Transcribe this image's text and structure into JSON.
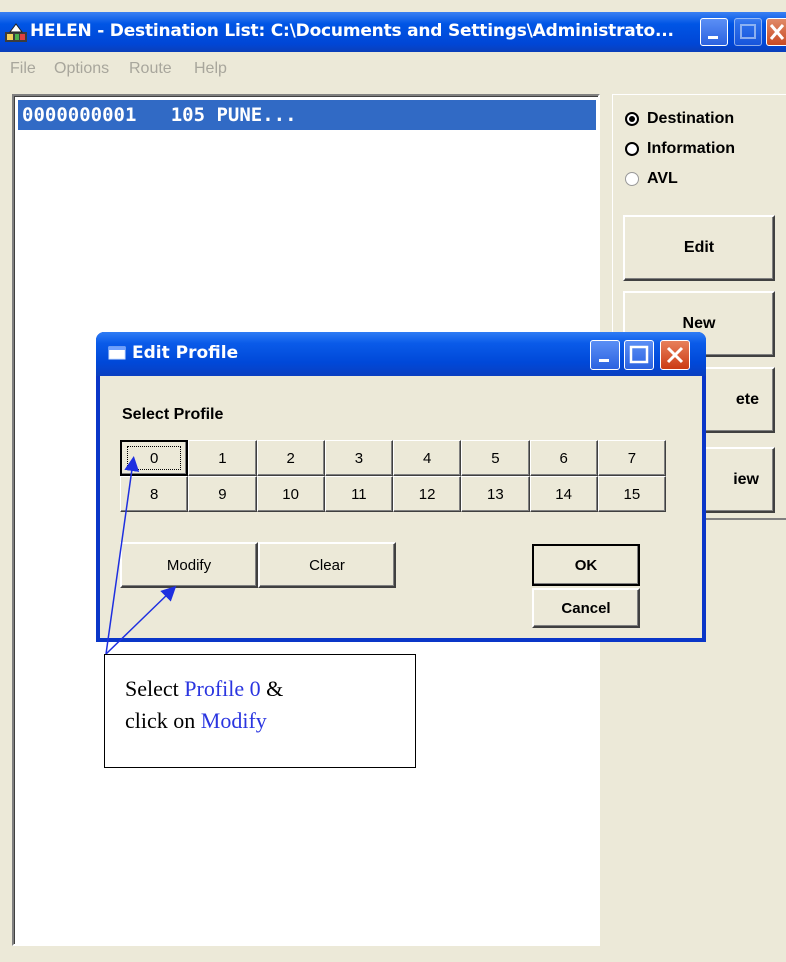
{
  "main_window": {
    "title": "HELEN - Destination List: C:\\Documents and Settings\\Administrato...",
    "menu": [
      "File",
      "Options",
      "Route",
      "Help"
    ],
    "list_items": [
      "0000000001   105 PUNE..."
    ]
  },
  "right_panel": {
    "radios": [
      {
        "label": "Destination",
        "checked": true
      },
      {
        "label": "Information",
        "checked": false
      },
      {
        "label": "AVL",
        "checked": false
      }
    ],
    "buttons": [
      "Edit",
      "New",
      "ete",
      "iew"
    ]
  },
  "dialog": {
    "title": "Edit Profile",
    "select_label": "Select Profile",
    "profiles": [
      "0",
      "1",
      "2",
      "3",
      "4",
      "5",
      "6",
      "7",
      "8",
      "9",
      "10",
      "11",
      "12",
      "13",
      "14",
      "15"
    ],
    "selected_profile": "0",
    "modify_label": "Modify",
    "clear_label": "Clear",
    "ok_label": "OK",
    "cancel_label": "Cancel"
  },
  "annotation": {
    "line1_prefix": "Select ",
    "line1_highlight": "Profile 0",
    "line1_suffix": " &",
    "line2_prefix": "click on ",
    "line2_highlight": "Modify"
  },
  "colors": {
    "titlebar": "#0055e5",
    "selection": "#316ac5",
    "annotation_highlight": "#2a35e0",
    "window_bg": "#ece9d8"
  }
}
